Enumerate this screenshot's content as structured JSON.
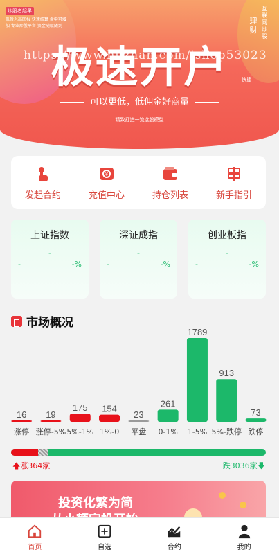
{
  "hero": {
    "tag": "炒股者起早",
    "small_lines": "低投入高回报 快速结算 盘中可增加 专业炒股平台 资金随取随到",
    "big_title": "极速开户",
    "watermark": "https://www.huzhan.com/ishop53023",
    "subtitle": "可以更低，低佣金好商量",
    "tiny": "精致打造一流选股模型",
    "vert_a": "互联网炒股",
    "vert_b": "理财",
    "vert_c": "快捷"
  },
  "nav": [
    {
      "label": "发起合约",
      "icon": "hand-tap-icon"
    },
    {
      "label": "充值中心",
      "icon": "recharge-icon"
    },
    {
      "label": "持仓列表",
      "icon": "wallet-icon"
    },
    {
      "label": "新手指引",
      "icon": "signpost-icon"
    }
  ],
  "indices": [
    {
      "name": "上证指数",
      "value": "-",
      "change": "-",
      "percent": "-%"
    },
    {
      "name": "深证成指",
      "value": "-",
      "change": "-",
      "percent": "-%"
    },
    {
      "name": "创业板指",
      "value": "-",
      "change": "-",
      "percent": "-%"
    }
  ],
  "market": {
    "title": "市场概况",
    "up_label": "涨364家",
    "down_label": "跌3036家",
    "up_ratio": 0.107
  },
  "chart_data": {
    "type": "bar",
    "categories": [
      "涨停",
      "涨停-5%",
      "5%-1%",
      "1%-0",
      "平盘",
      "0-1%",
      "1-5%",
      "5%-跌停",
      "跌停"
    ],
    "values": [
      16,
      19,
      175,
      154,
      23,
      261,
      1789,
      913,
      73
    ],
    "colors": [
      "#e8111a",
      "#e8111a",
      "#e8111a",
      "#e8111a",
      "#9a9a9a",
      "#1cb86a",
      "#1cb86a",
      "#1cb86a",
      "#1cb86a"
    ]
  },
  "banner": {
    "line1": "投资化繁为简",
    "line2": "从小额定投开始"
  },
  "tabs": [
    {
      "label": "首页",
      "icon": "home-icon",
      "active": true
    },
    {
      "label": "自选",
      "icon": "add-square-icon",
      "active": false
    },
    {
      "label": "合约",
      "icon": "trend-chart-icon",
      "active": false
    },
    {
      "label": "我的",
      "icon": "user-icon",
      "active": false
    }
  ],
  "colors": {
    "accent": "#d8463c",
    "up": "#e8111a",
    "down": "#1cb86a"
  }
}
